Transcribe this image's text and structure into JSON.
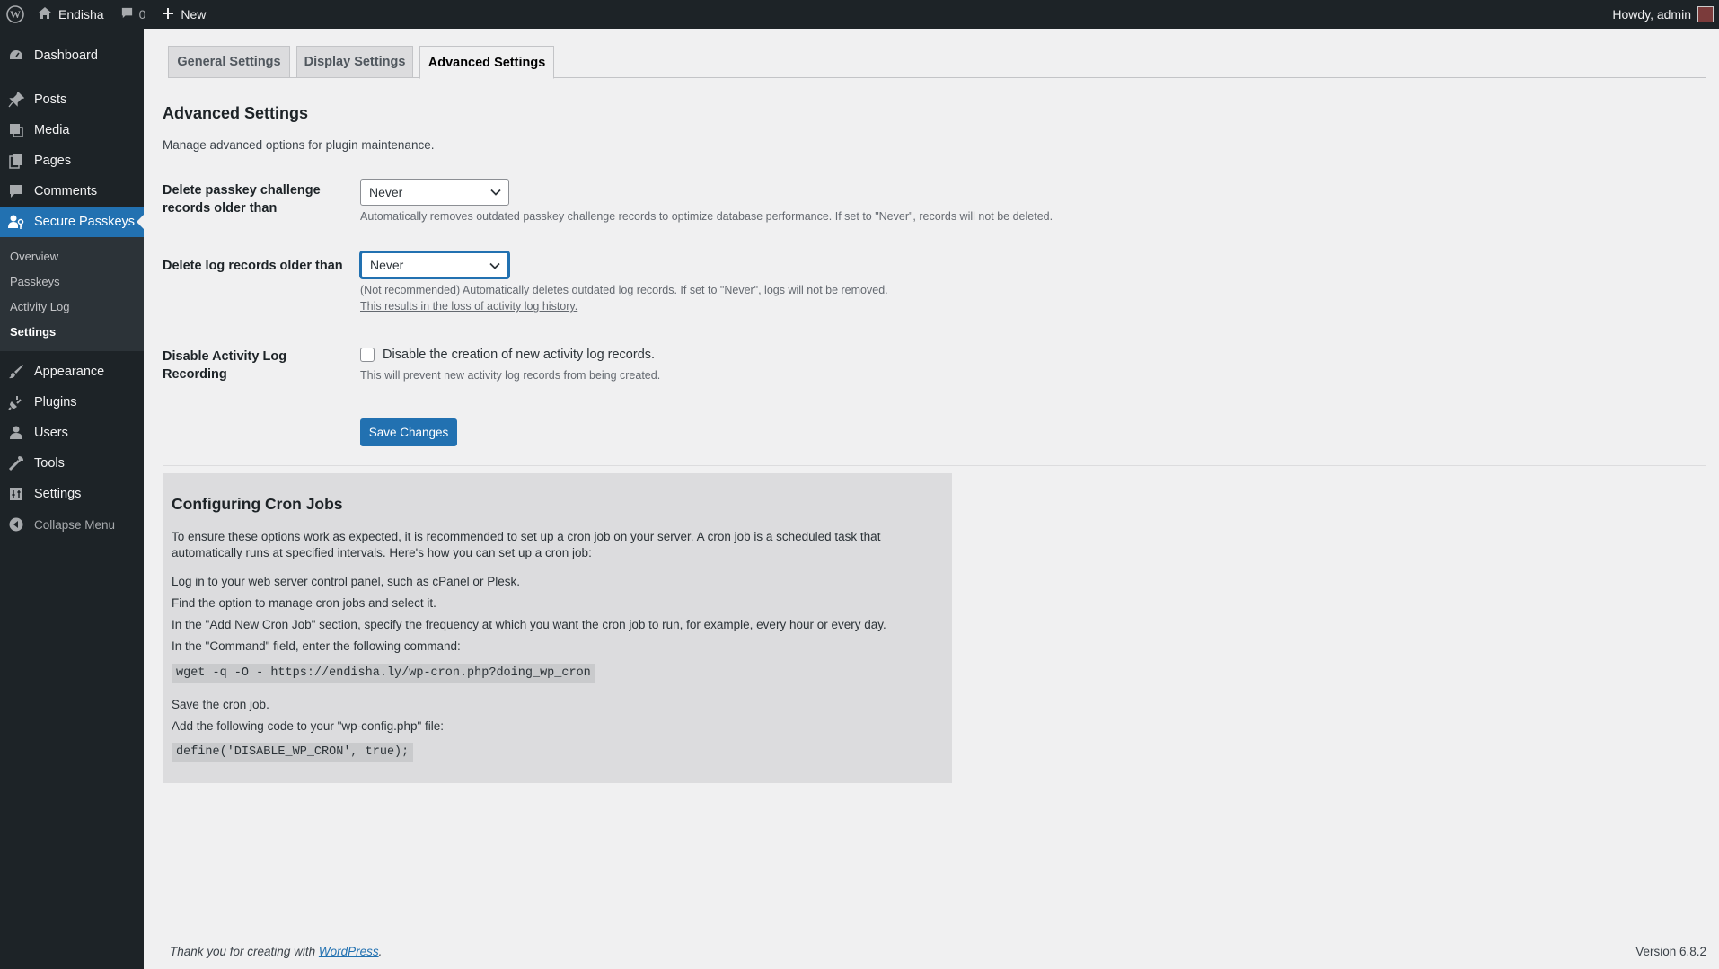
{
  "adminbar": {
    "site_name": "Endisha",
    "comments_count": "0",
    "new_label": "New",
    "howdy": "Howdy, admin"
  },
  "sidebar": {
    "items": [
      {
        "label": "Dashboard",
        "icon": "dashboard-icon"
      },
      {
        "label": "Posts",
        "icon": "pin-icon"
      },
      {
        "label": "Media",
        "icon": "media-icon"
      },
      {
        "label": "Pages",
        "icon": "pages-icon"
      },
      {
        "label": "Comments",
        "icon": "comment-icon"
      },
      {
        "label": "Secure Passkeys",
        "icon": "users-key-icon",
        "active": true
      },
      {
        "label": "Appearance",
        "icon": "brush-icon"
      },
      {
        "label": "Plugins",
        "icon": "plugin-icon"
      },
      {
        "label": "Users",
        "icon": "user-icon"
      },
      {
        "label": "Tools",
        "icon": "wrench-icon"
      },
      {
        "label": "Settings",
        "icon": "settings-icon"
      }
    ],
    "submenu": [
      "Overview",
      "Passkeys",
      "Activity Log",
      "Settings"
    ],
    "collapse": "Collapse Menu"
  },
  "tabs": [
    "General Settings",
    "Display Settings",
    "Advanced Settings"
  ],
  "main": {
    "title": "Advanced Settings",
    "intro": "Manage advanced options for plugin maintenance.",
    "challenge": {
      "label_line1": "Delete passkey challenge",
      "label_line2": "records older than",
      "value": "Never",
      "desc": "Automatically removes outdated passkey challenge records to optimize database performance. If set to \"Never\", records will not be deleted."
    },
    "logs": {
      "label": "Delete log records older than",
      "value": "Never",
      "desc": "(Not recommended) Automatically deletes outdated log records. If set to \"Never\", logs will not be removed.",
      "warning": "This results in the loss of activity log history."
    },
    "disable_log": {
      "label_line1": "Disable Activity Log",
      "label_line2": "Recording",
      "checkbox_label": "Disable the creation of new activity log records.",
      "checked": false,
      "desc": "This will prevent new activity log records from being created."
    },
    "save_label": "Save Changes"
  },
  "cron": {
    "title": "Configuring Cron Jobs",
    "intro_line1": "To ensure these options work as expected, it is recommended to set up a cron job on your server. A cron job is a scheduled task that",
    "intro_line2": "automatically runs at specified intervals. Here's how you can set up a cron job:",
    "steps": [
      "Log in to your web server control panel, such as cPanel or Plesk.",
      "Find the option to manage cron jobs and select it.",
      "In the \"Add New Cron Job\" section, specify the frequency at which you want the cron job to run, for example, every hour or every day.",
      "In the \"Command\" field, enter the following command:"
    ],
    "command": "wget -q -O - https://endisha.ly/wp-cron.php?doing_wp_cron",
    "save_step": "Save the cron job.",
    "config_step": "Add the following code to your \"wp-config.php\" file:",
    "config_code": "define('DISABLE_WP_CRON', true);"
  },
  "footer": {
    "thanks_prefix": "Thank you for creating with ",
    "link": "WordPress",
    "suffix": ".",
    "version": "Version 6.8.2"
  },
  "colors": {
    "admin_dark": "#1d2327",
    "accent": "#2271b1",
    "background": "#f0f0f1"
  }
}
